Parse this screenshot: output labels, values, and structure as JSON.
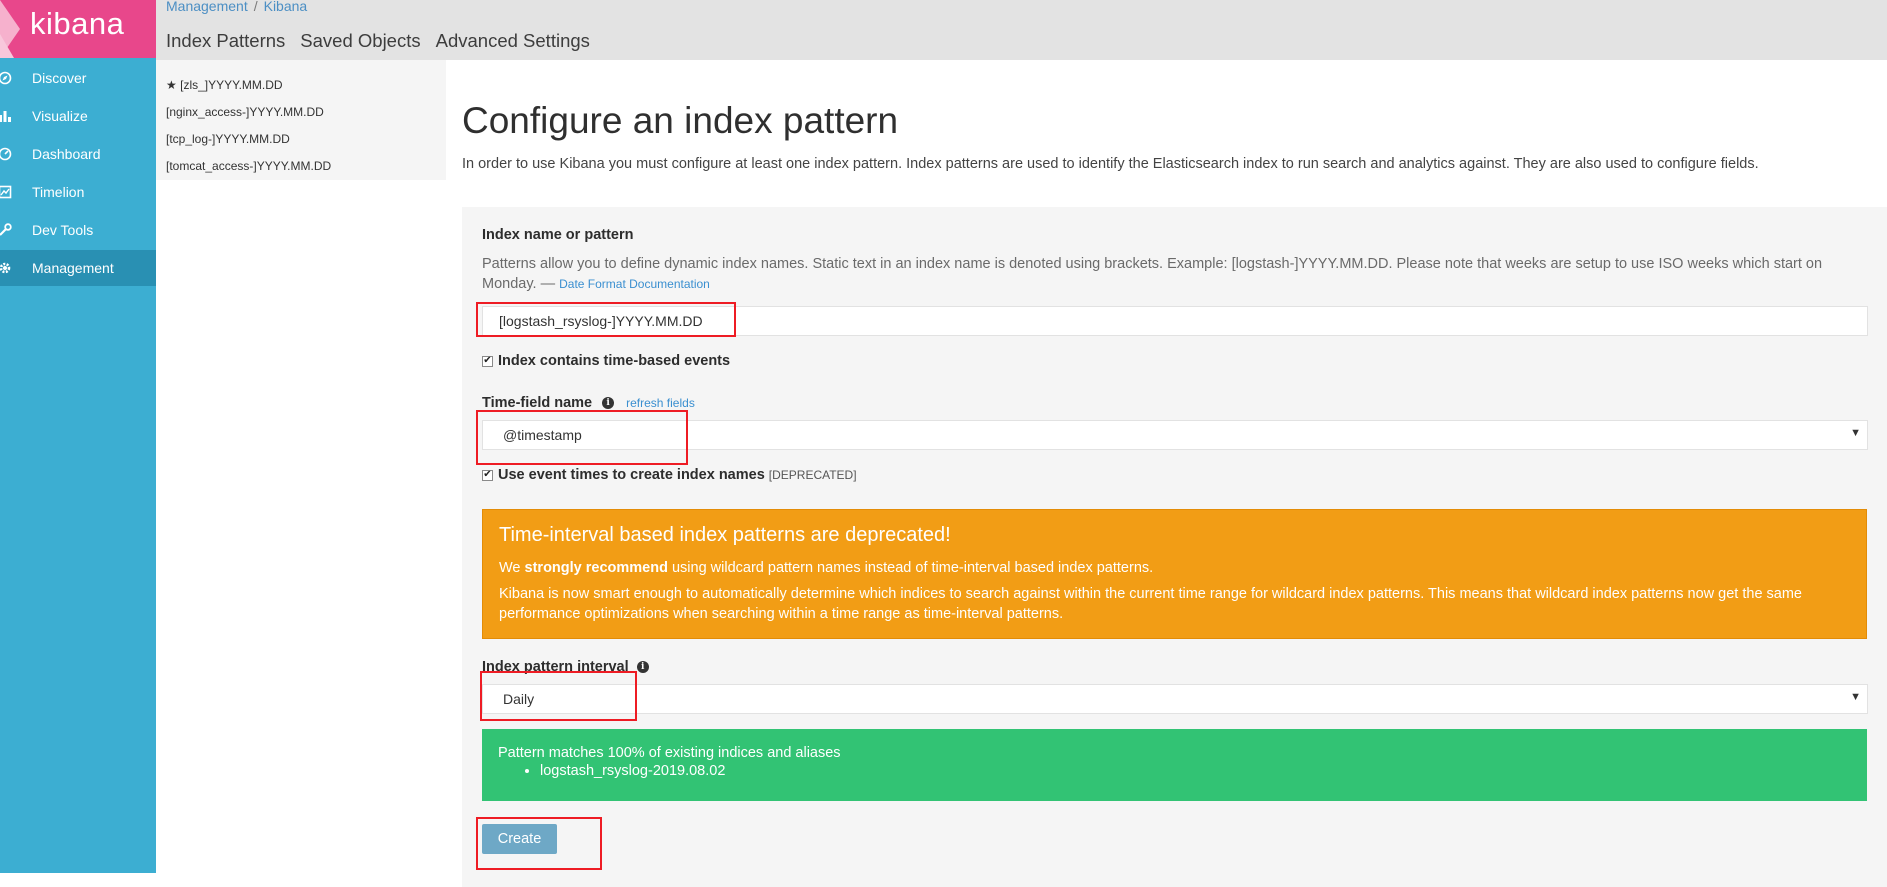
{
  "app": {
    "logo_text": "kibana",
    "brand_color": "#e8478b",
    "nav_color": "#3caed2",
    "accent_link": "#3a8fd0"
  },
  "nav": {
    "items": [
      {
        "label": "Discover",
        "icon": "compass-icon"
      },
      {
        "label": "Visualize",
        "icon": "bar-chart-icon"
      },
      {
        "label": "Dashboard",
        "icon": "dashboard-icon"
      },
      {
        "label": "Timelion",
        "icon": "timelion-icon"
      },
      {
        "label": "Dev Tools",
        "icon": "wrench-icon"
      },
      {
        "label": "Management",
        "icon": "gear-icon",
        "active": true
      }
    ]
  },
  "breadcrumb": {
    "first": "Management",
    "separator": "/",
    "second": "Kibana"
  },
  "tabs": [
    "Index Patterns",
    "Saved Objects",
    "Advanced Settings"
  ],
  "index_patterns": [
    {
      "label": "[zls_]YYYY.MM.DD",
      "default": true
    },
    {
      "label": "[nginx_access-]YYYY.MM.DD"
    },
    {
      "label": "[tcp_log-]YYYY.MM.DD"
    },
    {
      "label": "[tomcat_access-]YYYY.MM.DD"
    }
  ],
  "page": {
    "title": "Configure an index pattern",
    "intro": "In order to use Kibana you must configure at least one index pattern. Index patterns are used to identify the Elasticsearch index to run search and analytics against. They are also used to configure fields."
  },
  "form": {
    "index_name_label": "Index name or pattern",
    "index_name_help": "Patterns allow you to define dynamic index names. Static text in an index name is denoted using brackets. Example: [logstash-]YYYY.MM.DD. Please note that weeks are setup to use ISO weeks which start on Monday. —",
    "date_format_link": "Date Format Documentation",
    "index_name_value": "[logstash_rsyslog-]YYYY.MM.DD",
    "time_based_checkbox": {
      "label": "Index contains time-based events",
      "checked": true
    },
    "time_field_label": "Time-field name",
    "refresh_fields_link": "refresh fields",
    "time_field_value": "@timestamp",
    "event_times_checkbox": {
      "label": "Use event times to create index names",
      "tag": "[DEPRECATED]",
      "checked": true
    },
    "warning": {
      "title": "Time-interval based index patterns are deprecated!",
      "line1_prefix": "We",
      "line1_strong": "strongly recommend",
      "line1_suffix": "using wildcard pattern names instead of time-interval based index patterns.",
      "line2": "Kibana is now smart enough to automatically determine which indices to search against within the current time range for wildcard index patterns. This means that wildcard index patterns now get the same performance optimizations when searching within a time range as time-interval patterns."
    },
    "interval_label": "Index pattern interval",
    "interval_value": "Daily",
    "success": {
      "text": "Pattern matches 100% of existing indices and aliases",
      "matches": [
        "logstash_rsyslog-2019.08.02"
      ]
    },
    "create_button": "Create"
  }
}
